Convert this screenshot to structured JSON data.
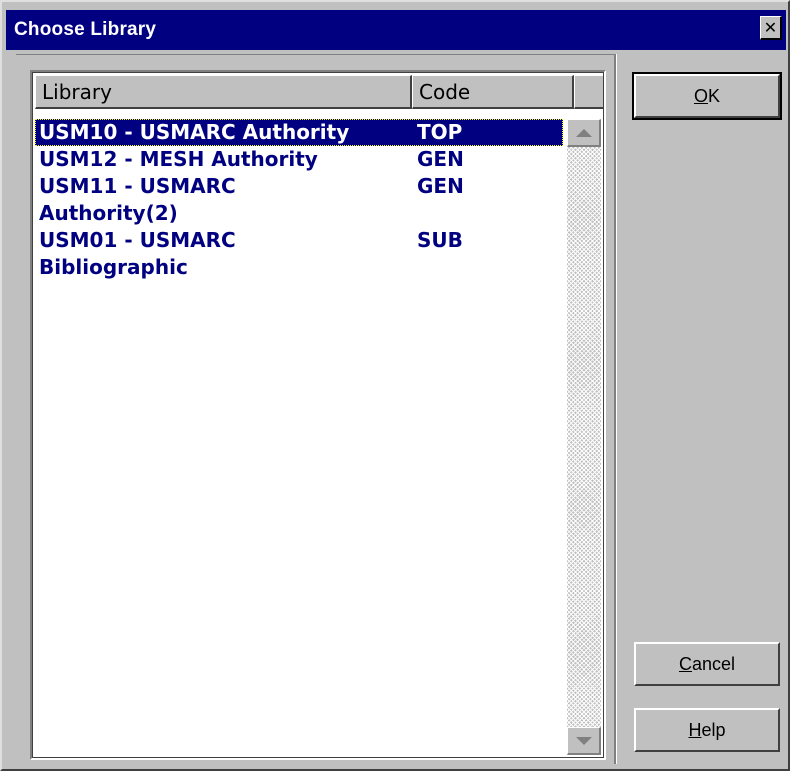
{
  "window": {
    "title": "Choose Library",
    "close_glyph": "✕"
  },
  "list": {
    "columns": [
      "Library",
      "Code"
    ],
    "rows": [
      {
        "library": "USM10 - USMARC Authority",
        "code": "TOP",
        "selected": true
      },
      {
        "library": "USM12 - MESH Authority",
        "code": "GEN",
        "selected": false
      },
      {
        "library": "USM11 - USMARC\nAuthority(2)",
        "code": "GEN",
        "selected": false
      },
      {
        "library": "USM01 - USMARC\nBibliographic",
        "code": "SUB",
        "selected": false
      }
    ]
  },
  "buttons": {
    "ok": {
      "accel": "O",
      "rest": "K"
    },
    "cancel": {
      "accel": "C",
      "rest": "ancel"
    },
    "help": {
      "accel": "H",
      "rest": "elp"
    }
  },
  "icons": {
    "scroll_up": "scroll-up-arrow-icon",
    "scroll_down": "scroll-down-arrow-icon",
    "close": "close-icon"
  },
  "colors": {
    "titlebar": "#000080",
    "selection": "#000080",
    "row_text": "#000080",
    "face": "#c0c0c0"
  }
}
